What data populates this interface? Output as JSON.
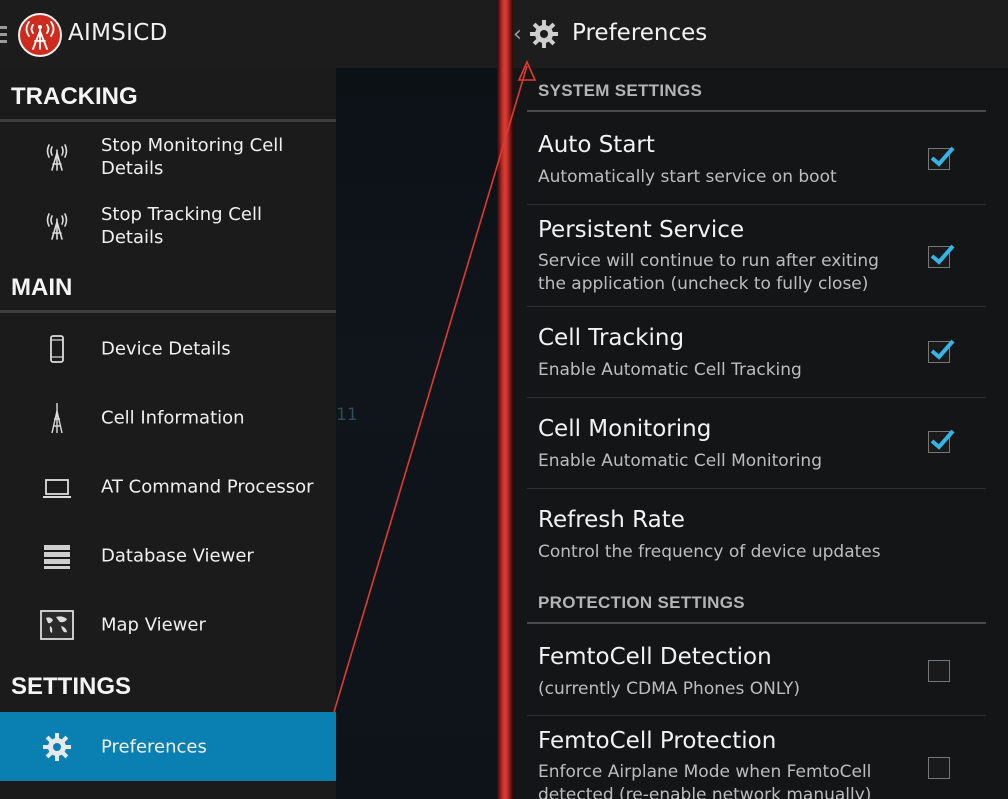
{
  "app": {
    "title": "AIMSICD"
  },
  "drawer": {
    "sections": [
      {
        "title": "TRACKING",
        "items": [
          {
            "label": "Stop Monitoring Cell Details",
            "icon": "cell-tower-icon"
          },
          {
            "label": "Stop Tracking Cell Details",
            "icon": "cell-tower-icon"
          }
        ]
      },
      {
        "title": "MAIN",
        "items": [
          {
            "label": "Device Details",
            "icon": "phone-icon"
          },
          {
            "label": "Cell Information",
            "icon": "antenna-icon"
          },
          {
            "label": "AT Command Processor",
            "icon": "laptop-icon"
          },
          {
            "label": "Database Viewer",
            "icon": "database-icon"
          },
          {
            "label": "Map Viewer",
            "icon": "map-icon"
          }
        ]
      },
      {
        "title": "SETTINGS",
        "items": [
          {
            "label": "Preferences",
            "icon": "gear-icon",
            "active": true
          }
        ]
      }
    ],
    "background_fragment": "11"
  },
  "preferences": {
    "title": "Preferences",
    "categories": [
      {
        "title": "SYSTEM SETTINGS",
        "items": [
          {
            "title": "Auto Start",
            "summary": "Automatically start service on boot",
            "checked": true
          },
          {
            "title": "Persistent Service",
            "summary": "Service will continue to run after exiting the application (uncheck to fully close)",
            "checked": true
          },
          {
            "title": "Cell Tracking",
            "summary": "Enable Automatic Cell Tracking",
            "checked": true
          },
          {
            "title": "Cell Monitoring",
            "summary": "Enable Automatic Cell Monitoring",
            "checked": true
          },
          {
            "title": "Refresh Rate",
            "summary": "Control the frequency of device updates",
            "checked": null
          }
        ]
      },
      {
        "title": "PROTECTION SETTINGS",
        "items": [
          {
            "title": "FemtoCell Detection",
            "summary": "(currently CDMA Phones ONLY)",
            "checked": false
          },
          {
            "title": "FemtoCell Protection",
            "summary": "Enforce Airplane Mode when FemtoCell detected (re-enable network manually)",
            "checked": false
          }
        ]
      }
    ]
  },
  "colors": {
    "accent": "#0a7fb1",
    "checkmark": "#33b5e5",
    "logo": "#cc2b1d",
    "annotation": "#e03a30"
  }
}
